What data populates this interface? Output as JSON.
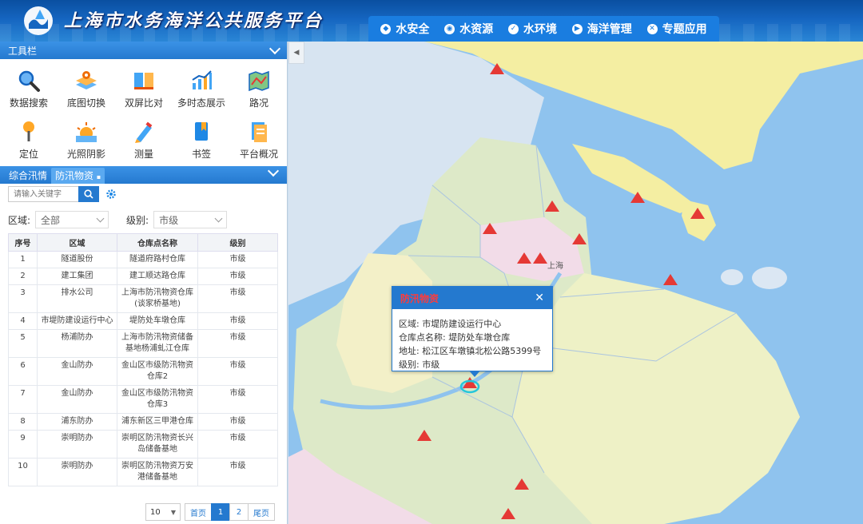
{
  "header": {
    "title": "上海市水务海洋公共服务平台",
    "nav": [
      "水安全",
      "水资源",
      "水环境",
      "海洋管理",
      "专题应用"
    ]
  },
  "toolbar": {
    "title": "工具栏",
    "tools": [
      "数据搜索",
      "底图切换",
      "双屏比对",
      "多时态展示",
      "路况",
      "定位",
      "光照阴影",
      "测量",
      "书签",
      "平台概况"
    ]
  },
  "tabs": [
    "综合汛情",
    "防汛物资"
  ],
  "search": {
    "placeholder": "请输入关键字"
  },
  "filters": {
    "region_label": "区域:",
    "region_value": "全部",
    "level_label": "级别:",
    "level_value": "市级"
  },
  "table": {
    "headers": [
      "序号",
      "区域",
      "仓库点名称",
      "级别"
    ],
    "rows": [
      [
        "1",
        "隧道股份",
        "隧道府路村仓库",
        "市级"
      ],
      [
        "2",
        "建工集团",
        "建工顺达路仓库",
        "市级"
      ],
      [
        "3",
        "排水公司",
        "上海市防汛物资仓库(谈家桥基地)",
        "市级"
      ],
      [
        "4",
        "市堤防建设运行中心",
        "堤防处车墩仓库",
        "市级"
      ],
      [
        "5",
        "杨浦防办",
        "上海市防汛物资储备基地杨浦虬江仓库",
        "市级"
      ],
      [
        "6",
        "金山防办",
        "金山区市级防汛物资仓库2",
        "市级"
      ],
      [
        "7",
        "金山防办",
        "金山区市级防汛物资仓库3",
        "市级"
      ],
      [
        "8",
        "浦东防办",
        "浦东新区三甲港仓库",
        "市级"
      ],
      [
        "9",
        "崇明防办",
        "崇明区防汛物资长兴岛储备基地",
        "市级"
      ],
      [
        "10",
        "崇明防办",
        "崇明区防汛物资万安港储备基地",
        "市级"
      ]
    ]
  },
  "pager": {
    "size": "10",
    "first": "首页",
    "pages": [
      "1",
      "2"
    ],
    "last": "尾页"
  },
  "popup": {
    "title": "防汛物资",
    "lines": [
      "区域: 市堤防建设运行中心",
      "仓库点名称: 堤防处车墩仓库",
      "地址: 松江区车墩镇北松公路5399号",
      "级别: 市级"
    ]
  },
  "map": {
    "label": "上海"
  },
  "colors": {
    "accent": "#2479cf",
    "marker": "#e53935",
    "water": "#8fc3ee"
  }
}
